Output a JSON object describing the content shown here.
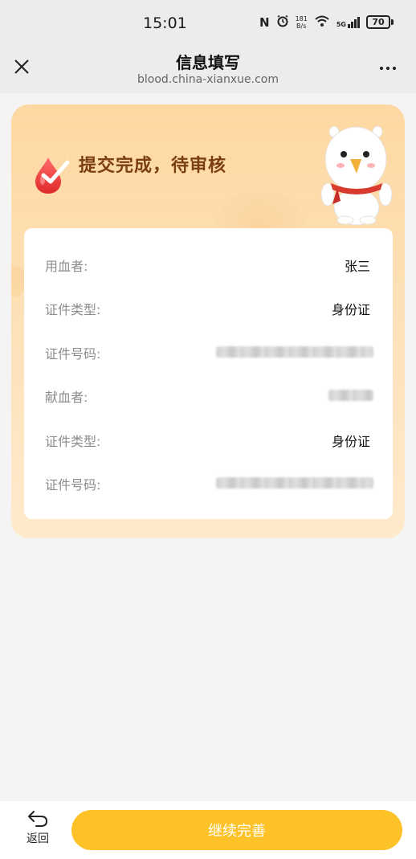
{
  "status_bar": {
    "time": "15:01",
    "nfc_icon": "N",
    "alarm_icon": "alarm-icon",
    "net_speed_value": "181",
    "net_speed_unit": "B/s",
    "network": "5G",
    "battery": "70"
  },
  "nav": {
    "title": "信息填写",
    "url": "blood.china-xianxue.com"
  },
  "card": {
    "status_title": "提交完成，待审核",
    "colors": {
      "title": "#7a3d14",
      "card_top": "#fed8a2",
      "card_bottom": "#feeacc"
    }
  },
  "info_rows": [
    {
      "label": "用血者:",
      "value": "张三"
    },
    {
      "label": "证件类型:",
      "value": "身份证"
    },
    {
      "label": "证件号码:",
      "value": ""
    },
    {
      "label": "献血者:",
      "value": ""
    },
    {
      "label": "证件类型:",
      "value": "身份证"
    },
    {
      "label": "证件号码:",
      "value": ""
    }
  ],
  "bottom": {
    "back_label": "返回",
    "continue_label": "继续完善",
    "accent": "#fcc227"
  }
}
